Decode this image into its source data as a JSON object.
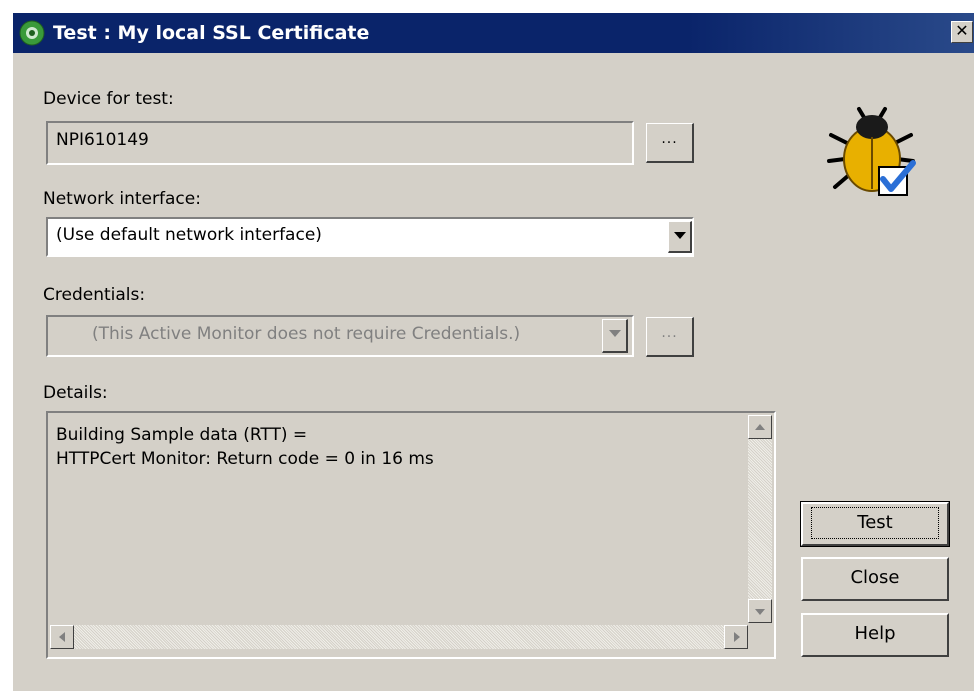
{
  "window": {
    "title": "Test : My local SSL Certificate",
    "close_glyph": "✕"
  },
  "device": {
    "label": "Device for test:",
    "value": "NPI610149",
    "browse_label": "..."
  },
  "network": {
    "label": "Network interface:",
    "selected": "(Use default network interface)"
  },
  "credentials": {
    "label": "Credentials:",
    "selected": "(This Active Monitor does not require Credentials.)",
    "browse_label": "..."
  },
  "details": {
    "label": "Details:",
    "lines": [
      "Building Sample data (RTT) =",
      "HTTPCert Monitor: Return code = 0 in 16 ms"
    ]
  },
  "buttons": {
    "test": "Test",
    "close": "Close",
    "help": "Help"
  },
  "icons": {
    "app": "app-globe-icon",
    "monitor": "bug-check-icon"
  },
  "colors": {
    "titlebar": "#0a246a",
    "face": "#d4d0c8",
    "check": "#2b6fd6",
    "bug": "#e8b000"
  }
}
